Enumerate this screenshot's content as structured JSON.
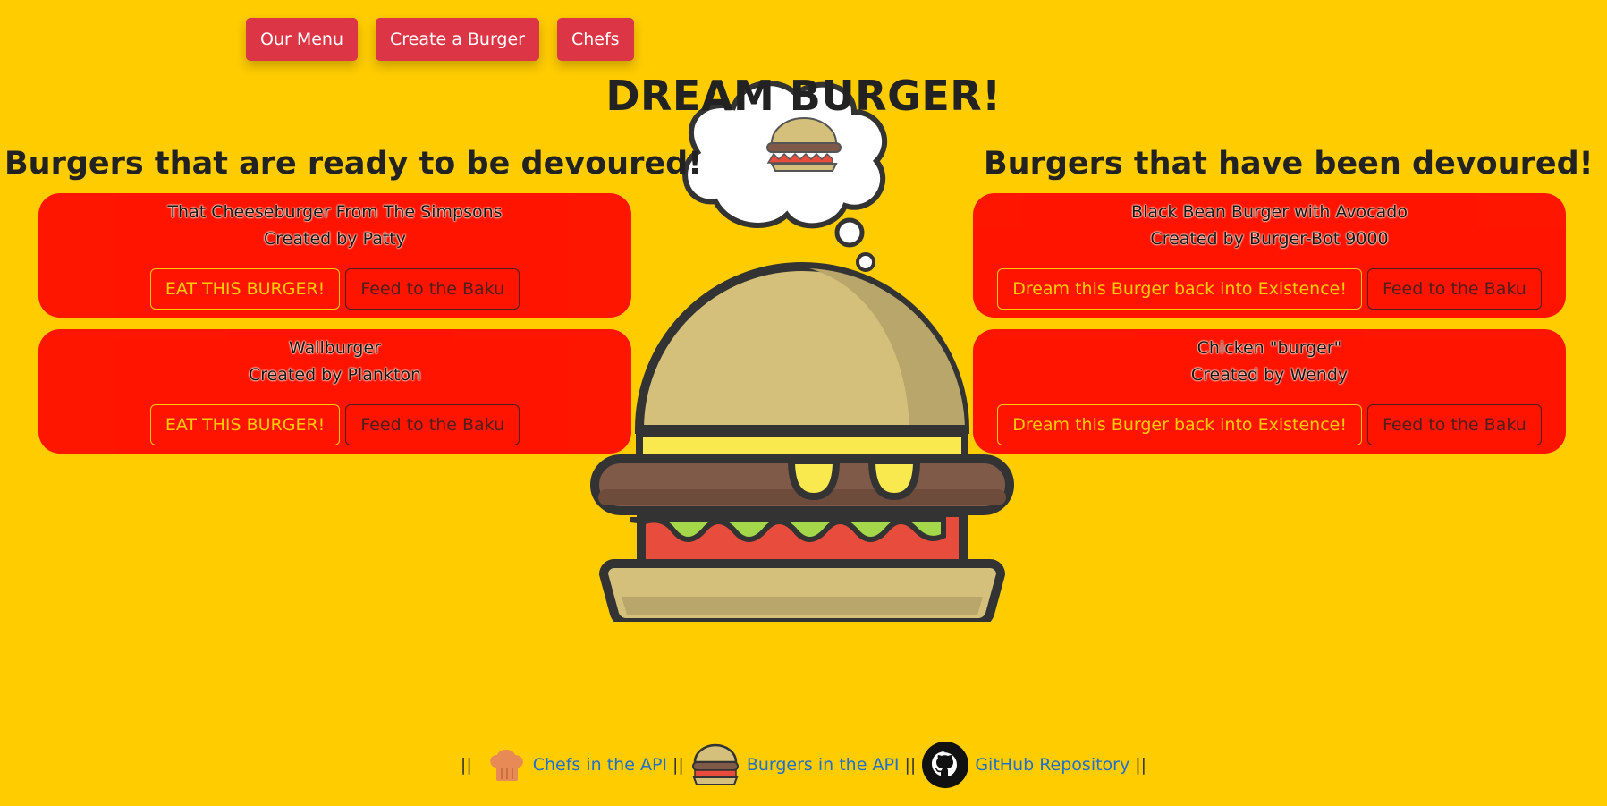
{
  "nav": {
    "items": [
      "Our Menu",
      "Create a Burger",
      "Chefs"
    ]
  },
  "title": "DREAM BURGER!",
  "columns": {
    "ready": {
      "heading": "Burgers that are ready to be devoured!",
      "cards": [
        {
          "name": "That Cheeseburger From The Simpsons",
          "creator": "Created by Patty",
          "primary": "EAT THIS BURGER!",
          "secondary": "Feed to the Baku"
        },
        {
          "name": "Wallburger",
          "creator": "Created by Plankton",
          "primary": "EAT THIS BURGER!",
          "secondary": "Feed to the Baku"
        }
      ]
    },
    "devoured": {
      "heading": "Burgers that have been devoured!",
      "cards": [
        {
          "name": "Black Bean Burger with Avocado",
          "creator": "Created by Burger-Bot 9000",
          "primary": "Dream this Burger back into Existence!",
          "secondary": "Feed to the Baku"
        },
        {
          "name": "Chicken \"burger\"",
          "creator": "Created by Wendy",
          "primary": "Dream this Burger back into Existence!",
          "secondary": "Feed to the Baku"
        }
      ]
    }
  },
  "footer": {
    "separator": "||",
    "links": [
      {
        "label": "Chefs in the API",
        "icon": "chef-hat-icon"
      },
      {
        "label": "Burgers in the API",
        "icon": "burger-icon"
      },
      {
        "label": "GitHub Repository",
        "icon": "github-icon"
      }
    ]
  },
  "colors": {
    "background": "#ffcc00",
    "card": "#ff0f00",
    "nav_button": "#dc3545",
    "accent": "#ffcc00",
    "link": "#1f6fcf"
  }
}
